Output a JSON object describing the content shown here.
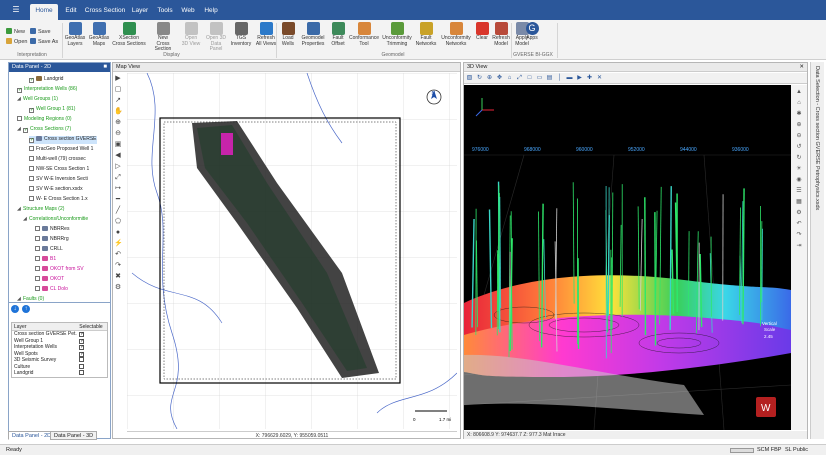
{
  "ribbon": {
    "file_icon": "menu-icon",
    "tabs": [
      "Home",
      "Edit",
      "Cross Section",
      "Layer",
      "Tools",
      "Web",
      "Help"
    ],
    "active_tab": "Home",
    "interpretation": {
      "new": "New",
      "save": "Save",
      "open": "Open",
      "save_as": "Save As",
      "group_label": "Interpretation"
    },
    "display_buttons": [
      {
        "label": "GeoAtlas\nLayers",
        "icon": "layers-icon",
        "color": "#3f6fb0",
        "enabled": true
      },
      {
        "label": "GeoAtlas\nMaps",
        "icon": "map-icon",
        "color": "#3f6fb0",
        "enabled": true
      },
      {
        "label": "XSection\nCross Sections",
        "icon": "xsection-icon",
        "color": "#2f8f4f",
        "enabled": true
      },
      {
        "label": "New\nCross Section",
        "icon": "new-xsection-icon",
        "color": "#888888",
        "enabled": true
      },
      {
        "label": "Open\n3D View",
        "icon": "open-3d-icon",
        "color": "#888888",
        "enabled": false
      },
      {
        "label": "Open 3D\nData Panel",
        "icon": "open-3d-panel-icon",
        "color": "#888888",
        "enabled": false
      },
      {
        "label": "TGS\nInventory",
        "icon": "inventory-icon",
        "color": "#666666",
        "enabled": true
      },
      {
        "label": "Refresh\nAll Views",
        "icon": "refresh-icon",
        "color": "#2b79c9",
        "enabled": true
      }
    ],
    "display_label": "Display",
    "geomodel_buttons": [
      {
        "label": "Load\nWells",
        "icon": "load-wells-icon",
        "color": "#7a4a2a",
        "enabled": true
      },
      {
        "label": "Geomodel\nProperties",
        "icon": "geomodel-properties-icon",
        "color": "#3b6aa8",
        "enabled": true
      },
      {
        "label": "Fault\nOffset",
        "icon": "fault-offset-icon",
        "color": "#3d8a5a",
        "enabled": true
      },
      {
        "label": "Conformance\nTool",
        "icon": "conformance-icon",
        "color": "#d8863a",
        "enabled": true
      },
      {
        "label": "Unconformity\nTrimming",
        "icon": "trimming-icon",
        "color": "#5a9a3a",
        "enabled": true
      },
      {
        "label": "Fault\nNetworks",
        "icon": "fault-networks-icon",
        "color": "#c9a227",
        "enabled": true
      },
      {
        "label": "Unconformity\nNetworks",
        "icon": "unconformity-networks-icon",
        "color": "#d8863a",
        "enabled": true
      },
      {
        "label": "Clear",
        "icon": "clear-icon",
        "color": "#d9362b",
        "enabled": true
      },
      {
        "label": "Refresh\nModel",
        "icon": "refresh-model-icon",
        "color": "#b84a3a",
        "enabled": true
      },
      {
        "label": "Apply\nModel",
        "icon": "apply-model-icon",
        "color": "#7a8aa8",
        "enabled": true
      }
    ],
    "geomodel_label": "Geomodel",
    "apps": {
      "label": "Apps",
      "icon": "apps-icon",
      "group_label": "GVERSE BI-GGX"
    }
  },
  "data_panel": {
    "title": "Data Panel - 2D",
    "tree": [
      {
        "label": "Landgrid",
        "indent": 3,
        "check": true,
        "color": "default",
        "icon": "grid-icon"
      },
      {
        "label": "Interpretation Wells (86)",
        "indent": 1,
        "check": true,
        "color": "green",
        "icon": ""
      },
      {
        "label": "Well Groups (1)",
        "indent": 1,
        "expand": true,
        "color": "green",
        "icon": ""
      },
      {
        "label": "Well Group 1 (81)",
        "indent": 3,
        "check": true,
        "color": "green",
        "icon": ""
      },
      {
        "label": "Modeling Regions (0)",
        "indent": 1,
        "check": false,
        "color": "green",
        "icon": ""
      },
      {
        "label": "Cross Sections (7)",
        "indent": 1,
        "expand": true,
        "check": true,
        "color": "green",
        "icon": ""
      },
      {
        "label": "Cross section GVERSE",
        "indent": 3,
        "check": true,
        "color": "default",
        "selected": true,
        "icon": "xsection-icon"
      },
      {
        "label": "FracGeo Proposed Well 1",
        "indent": 3,
        "check": false,
        "color": "default",
        "icon": ""
      },
      {
        "label": "Multi-well (79) crossec",
        "indent": 3,
        "check": false,
        "color": "default",
        "icon": ""
      },
      {
        "label": "NW-SE Cross Section 1",
        "indent": 3,
        "check": false,
        "color": "default",
        "icon": ""
      },
      {
        "label": "SV W-E Inversion Secti",
        "indent": 3,
        "check": false,
        "color": "default",
        "icon": ""
      },
      {
        "label": "SV W-E section.xsdx",
        "indent": 3,
        "check": false,
        "color": "default",
        "icon": ""
      },
      {
        "label": "W- E Cross Section 1.x",
        "indent": 3,
        "check": false,
        "color": "default",
        "icon": ""
      },
      {
        "label": "Structure Maps (2)",
        "indent": 1,
        "expand": true,
        "color": "green",
        "icon": ""
      },
      {
        "label": "Correlations/Unconformitie",
        "indent": 2,
        "expand": true,
        "color": "green",
        "icon": ""
      },
      {
        "label": "NBRRes",
        "indent": 4,
        "check": false,
        "color": "default",
        "icon": "surface-icon"
      },
      {
        "label": "NBRRrg",
        "indent": 4,
        "check": false,
        "color": "default",
        "icon": "surface-icon"
      },
      {
        "label": "CRLL",
        "indent": 4,
        "check": false,
        "color": "default",
        "icon": "surface-icon"
      },
      {
        "label": "B1",
        "indent": 4,
        "check": false,
        "color": "magenta",
        "icon": "surface-icon"
      },
      {
        "label": "OKOT from SV",
        "indent": 4,
        "check": false,
        "color": "magenta",
        "icon": "surface-icon"
      },
      {
        "label": "OKOT",
        "indent": 4,
        "check": false,
        "color": "magenta",
        "icon": "surface-icon"
      },
      {
        "label": "CL Dolo",
        "indent": 4,
        "check": false,
        "color": "magenta",
        "icon": "surface-icon"
      },
      {
        "label": "Faults (0)",
        "indent": 1,
        "expand": true,
        "color": "green",
        "icon": ""
      }
    ],
    "layers_header": {
      "layer": "Layer",
      "selectable": "Selectable"
    },
    "layers": [
      {
        "name": "Cross section GVERSE Pet...",
        "selectable": true
      },
      {
        "name": "Well Group 1",
        "selectable": true
      },
      {
        "name": "Interpretation Wells",
        "selectable": true
      },
      {
        "name": "Well Spots",
        "selectable": true
      },
      {
        "name": "3D Seismic Survey",
        "selectable": false
      },
      {
        "name": "Culture",
        "selectable": false
      },
      {
        "name": "Landgrid",
        "selectable": false
      }
    ],
    "tabs": [
      "Data Panel - 2D",
      "Data Panel - 3D"
    ],
    "active_tab": "Data Panel - 2D"
  },
  "map_view": {
    "title": "Map View",
    "north_label": "N",
    "scale_start": "0",
    "scale_end": "1.7 mi",
    "status": "X: 796629.6029, Y: 955059.0511",
    "tool_icons": [
      "pointer-icon",
      "select-icon",
      "arrow-icon",
      "hand-icon",
      "zoom-in-icon",
      "zoom-out-icon",
      "zoom-window-icon",
      "zoom-prev-icon",
      "zoom-next-icon",
      "zoom-extent-icon",
      "measure-icon",
      "ruler-icon",
      "draw-line-icon",
      "draw-polygon-icon",
      "well-icon",
      "fault-icon",
      "undo-icon",
      "redo-icon",
      "delete-icon",
      "settings-icon"
    ]
  },
  "view_3d": {
    "title": "3D View",
    "close_icon": "close-icon",
    "axis_labels": [
      "976000",
      "968000",
      "960000",
      "952000",
      "944000",
      "936000"
    ],
    "vertical_scale_label": "Vertical\nScale",
    "vertical_scale_value": "2.45",
    "status": "X: 806608.9     Y: 974637.7     Z: 977.3     Mat Irrace",
    "toolbar_icons": [
      "cube-icon",
      "rotate-icon",
      "zoom-icon",
      "pan-icon",
      "home-view-icon",
      "fit-icon",
      "front-view-icon",
      "side-view-icon",
      "top-view-icon",
      "well-view-icon",
      "surface-view-icon",
      "pointer-icon",
      "pick-icon",
      "close-icon"
    ],
    "right_tool_icons": [
      "arrow-up-icon",
      "home-icon",
      "compass-icon",
      "zoom-in-icon",
      "zoom-out-icon",
      "rotate-left-icon",
      "rotate-right-icon",
      "light-icon",
      "camera-icon",
      "layers-icon",
      "grid-icon",
      "settings-icon",
      "undo-icon",
      "redo-icon",
      "export-icon"
    ]
  },
  "side_strip": {
    "label": "Data Selection - Cross section GVERSE Petrophysics.xsdx"
  },
  "status_bar": {
    "ready": "Ready",
    "crs": "SCM FBP",
    "unit": "SL Public"
  },
  "colors": {
    "ribbon_blue": "#2b579a",
    "panel_blue": "#8aa4c8",
    "selection": "#cde4fb"
  }
}
